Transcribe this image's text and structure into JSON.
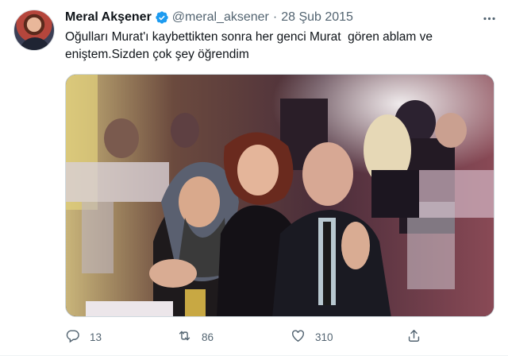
{
  "tweet": {
    "author_name": "Meral Akşener",
    "handle": "@meral_aksener",
    "separator": "·",
    "date": "28 Şub 2015",
    "text": "Oğulları Murat'ı kaybettikten sonra her genci Murat  gören ablam ve\neniştem.Sizden çok şey öğrendim",
    "verified": true,
    "verified_color": "#1d9bf0"
  },
  "actions": {
    "reply_count": "13",
    "retweet_count": "86",
    "like_count": "310"
  },
  "icons": {
    "more": "more-icon",
    "reply": "reply-icon",
    "retweet": "retweet-icon",
    "like": "heart-icon",
    "share": "share-icon"
  }
}
